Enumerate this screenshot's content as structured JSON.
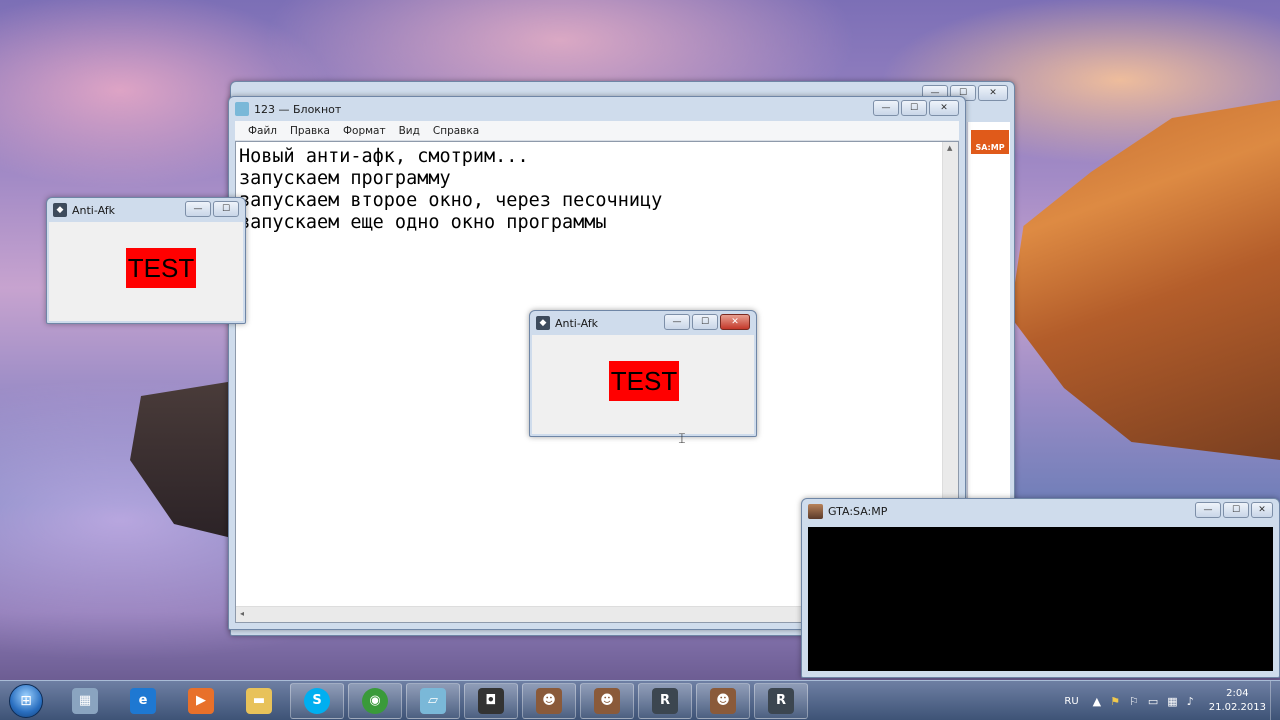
{
  "notepad": {
    "title": "123 — Блокнот",
    "menu": [
      "Файл",
      "Правка",
      "Формат",
      "Вид",
      "Справка"
    ],
    "lines": [
      "Новый анти-афк, смотрим...",
      "запускаем программу",
      "запускаем второе окно, через песочницу",
      "запускаем еще одно окно программы"
    ]
  },
  "bg_window": {
    "logo_text": "SA:MP"
  },
  "anti_afk_windows": [
    {
      "title": "Anti-Afk",
      "button_text": "TEST"
    },
    {
      "title": "Anti-Afk",
      "button_text": "TEST"
    }
  ],
  "gta_window": {
    "title": "GTA:SA:MP"
  },
  "window_controls": {
    "minimize": "—",
    "maximize": "☐",
    "close": "✕"
  },
  "taskbar": {
    "items": [
      {
        "name": "calculator",
        "icon": "calculator-icon",
        "state": "pinned",
        "color": "#8aa4c0"
      },
      {
        "name": "internet-explorer",
        "icon": "ie-icon",
        "state": "pinned",
        "color": "#1e78d2"
      },
      {
        "name": "media-player",
        "icon": "media-icon",
        "state": "pinned",
        "color": "#e8702a"
      },
      {
        "name": "explorer",
        "icon": "folder-icon",
        "state": "pinned",
        "color": "#e8c25a"
      },
      {
        "name": "skype",
        "icon": "skype-icon",
        "state": "open",
        "color": "#00aff0"
      },
      {
        "name": "chrome",
        "icon": "chrome-icon",
        "state": "open",
        "color": "#3a9a3a"
      },
      {
        "name": "notepad",
        "icon": "notepad-icon",
        "state": "open",
        "color": "#7ab8d8"
      },
      {
        "name": "hypercam",
        "icon": "hypercam-icon",
        "state": "open",
        "color": "#333333"
      },
      {
        "name": "samp-1",
        "icon": "samp-character-icon",
        "state": "open",
        "color": "#8a5a3a"
      },
      {
        "name": "samp-2",
        "icon": "samp-character-icon",
        "state": "open",
        "color": "#8a5a3a"
      },
      {
        "name": "rockstar-1",
        "icon": "rockstar-icon",
        "state": "open",
        "color": "#3c4650"
      },
      {
        "name": "samp-3",
        "icon": "samp-character-icon",
        "state": "open",
        "color": "#8a5a3a"
      },
      {
        "name": "rockstar-2",
        "icon": "rockstar-icon",
        "state": "open",
        "color": "#3c4650"
      }
    ],
    "tray": {
      "language": "RU",
      "time": "2:04",
      "date": "21.02.2013"
    }
  }
}
